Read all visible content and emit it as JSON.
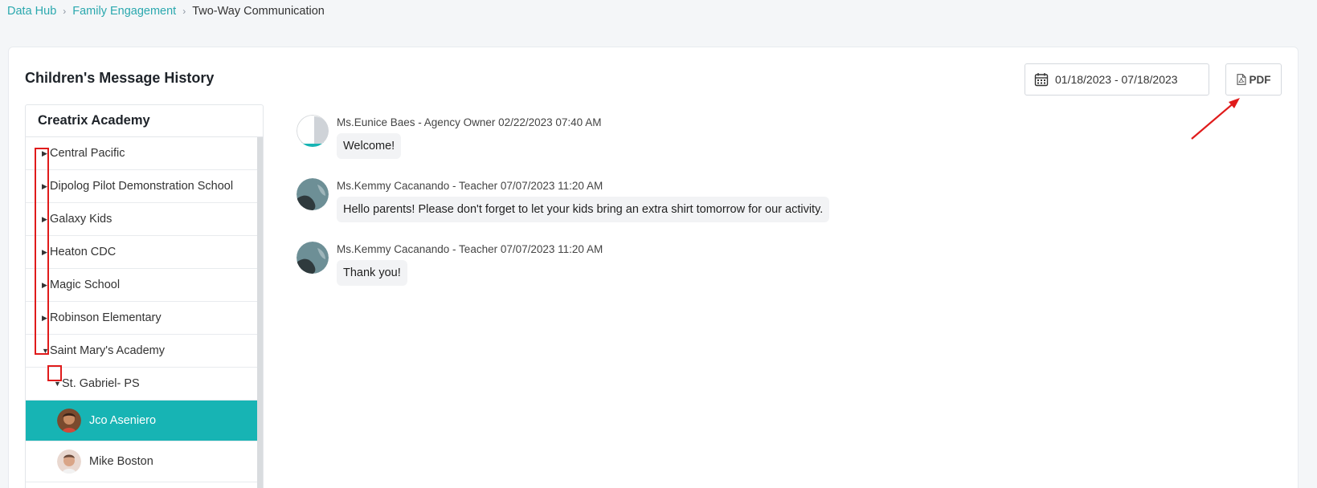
{
  "breadcrumb": {
    "items": [
      "Data Hub",
      "Family Engagement"
    ],
    "current": "Two-Way Communication"
  },
  "page": {
    "title": "Children's Message History",
    "date_range": "01/18/2023 - 07/18/2023",
    "pdf_label": "PDF"
  },
  "tree": {
    "header": "Creatrix Academy",
    "schools": [
      "Central Pacific",
      "Dipolog Pilot Demonstration School",
      "Galaxy Kids",
      "Heaton CDC",
      "Magic School",
      "Robinson Elementary",
      "Saint Mary's Academy"
    ],
    "sub_group": "St. Gabriel- PS",
    "children": [
      "Jco Aseniero",
      "Mike Boston"
    ]
  },
  "messages": [
    {
      "meta": "Ms.Eunice Baes - Agency Owner 02/22/2023 07:40 AM",
      "text": "Welcome!"
    },
    {
      "meta": "Ms.Kemmy Cacanando - Teacher 07/07/2023 11:20 AM",
      "text": "Hello parents! Please don't forget to let your kids bring an extra shirt tomorrow for our activity."
    },
    {
      "meta": "Ms.Kemmy Cacanando - Teacher 07/07/2023 11:20 AM",
      "text": "Thank you!"
    }
  ],
  "colors": {
    "accent": "#17b4b4",
    "link": "#2aa8ae",
    "annotation": "#e01b1b"
  }
}
